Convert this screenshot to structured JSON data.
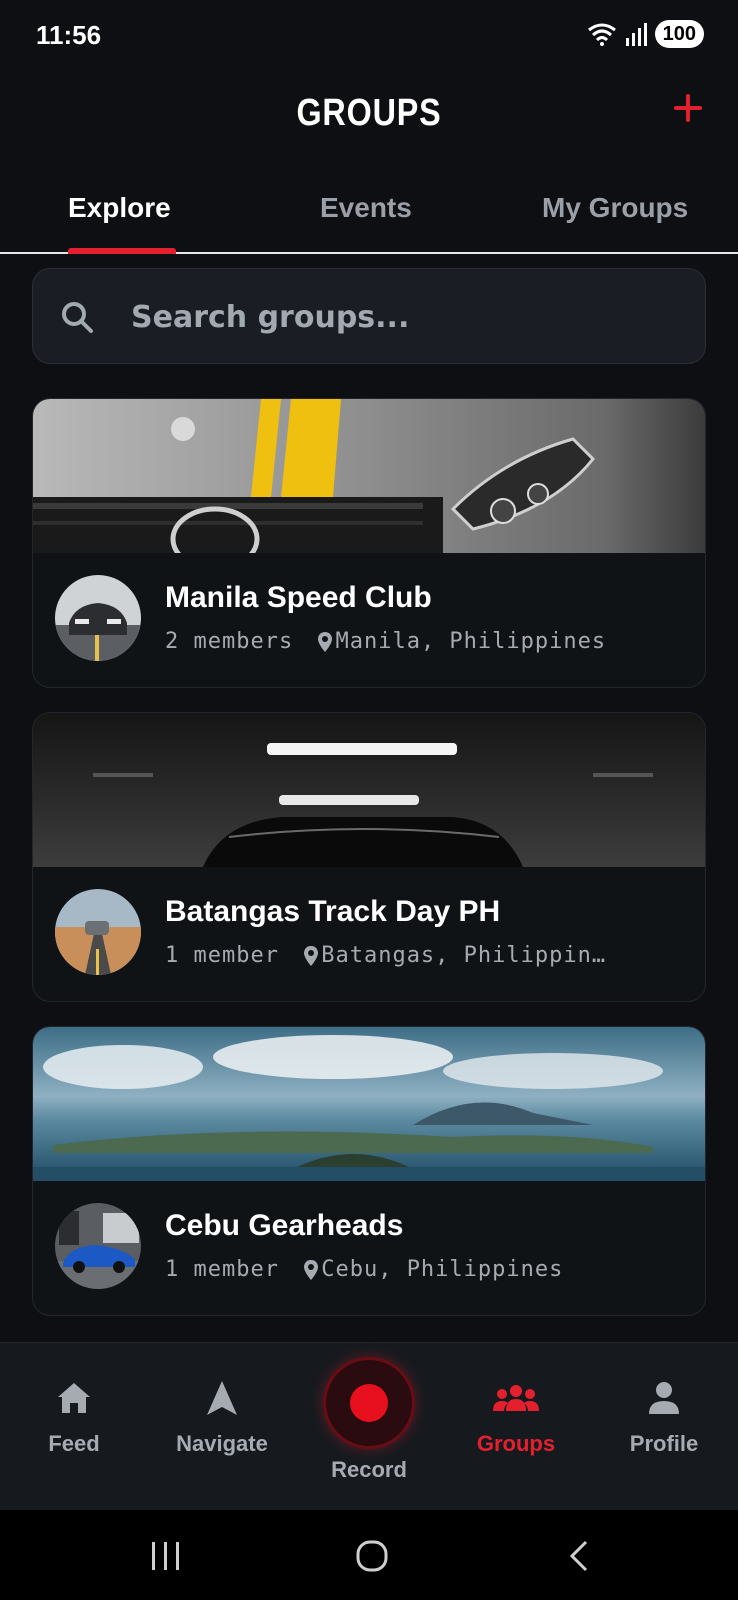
{
  "status": {
    "time": "11:56",
    "battery": "100"
  },
  "header": {
    "title": "GROUPS",
    "add_icon": "plus-icon",
    "accent_color": "#e5202e"
  },
  "tabs": [
    {
      "label": "Explore",
      "active": true
    },
    {
      "label": "Events",
      "active": false
    },
    {
      "label": "My Groups",
      "active": false
    }
  ],
  "search": {
    "placeholder": "Search groups...",
    "value": ""
  },
  "groups": [
    {
      "name": "Manila Speed Club",
      "members": "2 members",
      "location": "Manila, Philippines",
      "banner": "silver car hood with yellow stripe",
      "avatar": "sports car on road"
    },
    {
      "name": "Batangas Track Day PH",
      "members": "1 member",
      "location": "Batangas, Philippin…",
      "banner": "car in dark garage",
      "avatar": "car on desert road"
    },
    {
      "name": "Cebu Gearheads",
      "members": "1 member",
      "location": "Cebu, Philippines",
      "banner": "lake and volcano landscape",
      "avatar": "blue car"
    }
  ],
  "bottom_nav": [
    {
      "label": "Feed",
      "icon": "home-icon"
    },
    {
      "label": "Navigate",
      "icon": "navigation-arrow-icon"
    },
    {
      "label": "Record",
      "icon": "record-icon"
    },
    {
      "label": "Groups",
      "icon": "groups-icon",
      "active": true
    },
    {
      "label": "Profile",
      "icon": "profile-icon"
    }
  ]
}
